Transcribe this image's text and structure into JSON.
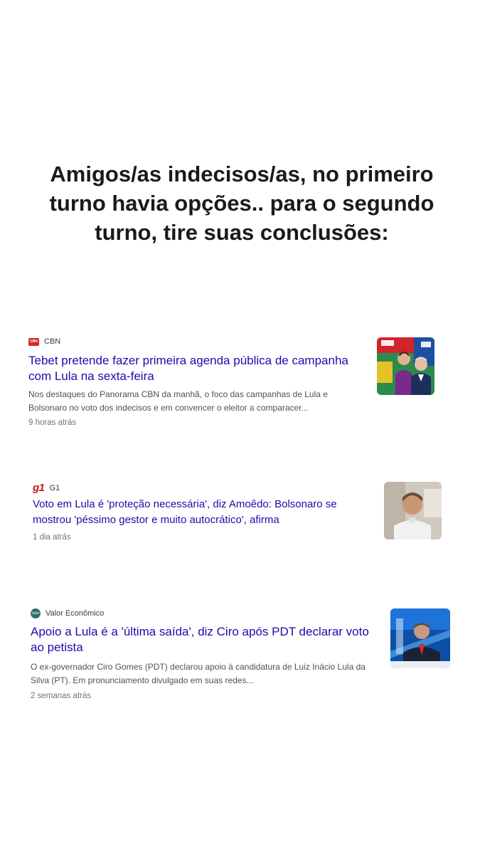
{
  "heading": "Amigos/as indecisos/as, no primeiro turno havia opções.. para o segundo turno, tire suas conclusões:",
  "articles": [
    {
      "logo": "CBN",
      "source": "CBN",
      "headline": "Tebet pretende fazer primeira agenda pública de campanha com Lula na sexta-feira",
      "snippet": "Nos destaques do Panorama CBN da manhã, o foco das campanhas de Lula e Bolsonaro no voto dos indecisos e em convencer o eleitor a comparacer...",
      "time": "9 horas atrás"
    },
    {
      "logo": "g1",
      "source": "G1",
      "headline": "Voto em Lula é 'proteção necessária', diz Amoêdo: Bolsonaro se mostrou 'péssimo gestor e muito autocrático', afirma",
      "time": "1 dia atrás"
    },
    {
      "logo": "Valor",
      "source": "Valor Econômico",
      "headline": "Apoio a Lula é a 'última saída', diz Ciro após PDT declarar voto ao petista",
      "snippet": "O ex-governador Ciro Gomes (PDT) declarou apoio à candidatura de Luiz Inácio Lula da Silva (PT). Em pronunciamento divulgado em suas redes...",
      "time": "2 semanas atrás"
    }
  ],
  "colors": {
    "headline": "#1a0dab",
    "snippet": "#4d5156",
    "time": "#70757a",
    "cbn_red": "#d22828",
    "g1_red": "#c4170c"
  }
}
